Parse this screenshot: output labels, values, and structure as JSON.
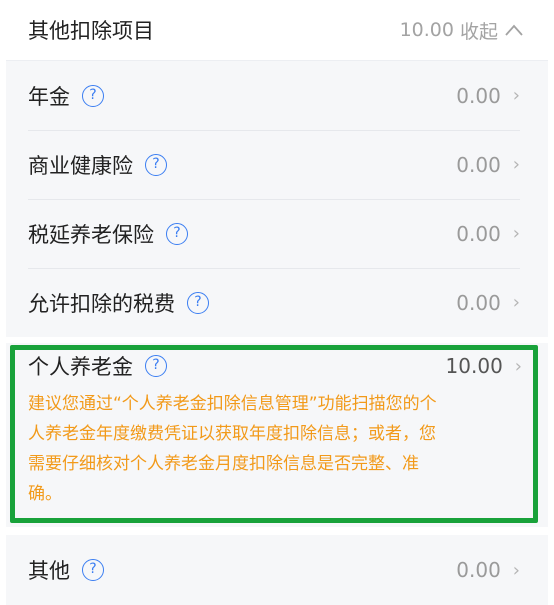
{
  "header": {
    "title": "其他扣除项目",
    "total": "10.00",
    "collapse": "收起"
  },
  "rows": [
    {
      "label": "年金",
      "value": "0.00"
    },
    {
      "label": "商业健康险",
      "value": "0.00"
    },
    {
      "label": "税延养老保险",
      "value": "0.00"
    },
    {
      "label": "允许扣除的税费",
      "value": "0.00"
    }
  ],
  "pension": {
    "label": "个人养老金",
    "value": "10.00",
    "notice": "建议您通过“个人养老金扣除信息管理”功能扫描您的个人养老金年度缴费凭证以获取年度扣除信息；或者，您需要仔细核对个人养老金月度扣除信息是否完整、准确。"
  },
  "other": {
    "label": "其他",
    "value": "0.00"
  },
  "colors": {
    "highlight": "#19a23a",
    "notice": "#f29a1a",
    "help_icon": "#3b7ef2"
  },
  "icons": {
    "help": "question-circle-icon",
    "chevron": "chevron-right-icon",
    "collapse": "chevron-up-icon"
  }
}
